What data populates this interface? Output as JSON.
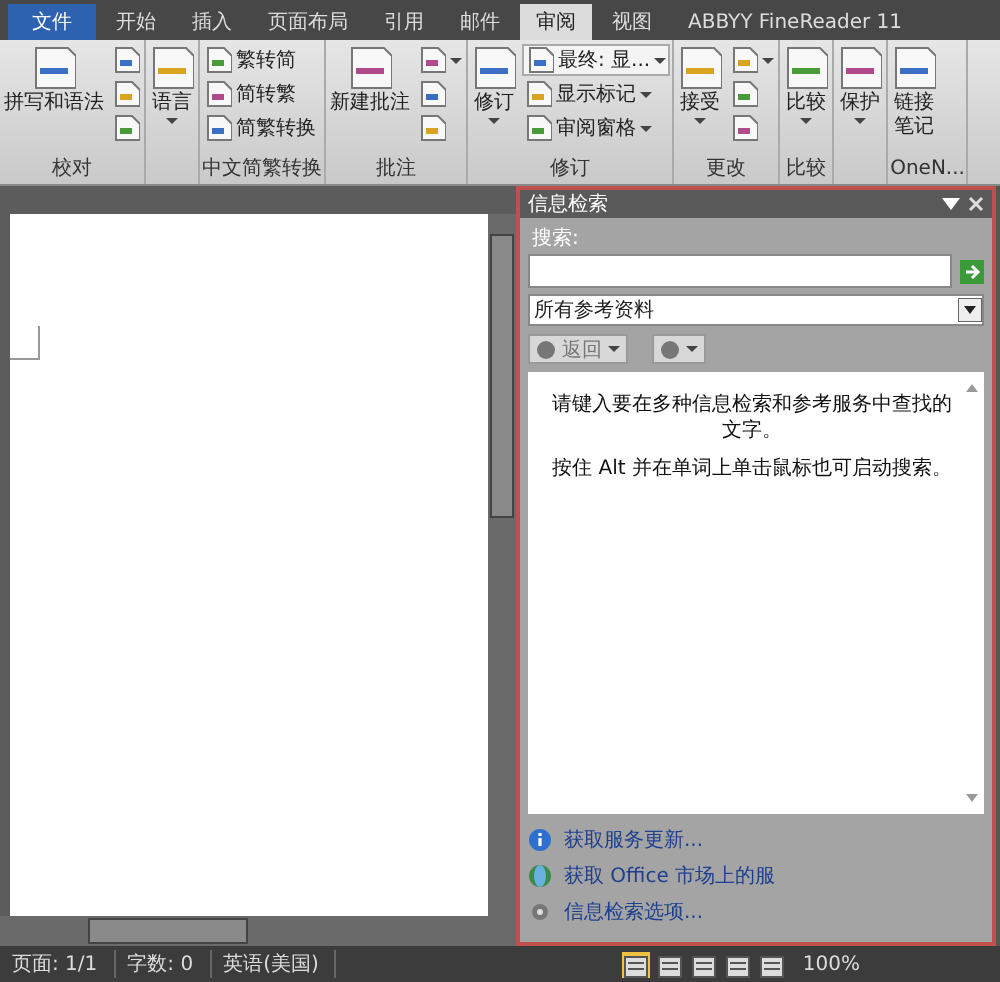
{
  "tabs": [
    {
      "label": "文件",
      "kind": "file",
      "selected": false
    },
    {
      "label": "开始",
      "kind": "tab",
      "selected": false
    },
    {
      "label": "插入",
      "kind": "tab",
      "selected": false
    },
    {
      "label": "页面布局",
      "kind": "tab",
      "selected": false
    },
    {
      "label": "引用",
      "kind": "tab",
      "selected": false
    },
    {
      "label": "邮件",
      "kind": "tab",
      "selected": false
    },
    {
      "label": "审阅",
      "kind": "tab",
      "selected": true
    },
    {
      "label": "视图",
      "kind": "tab",
      "selected": false
    },
    {
      "label": "ABBYY FineReader 11",
      "kind": "tab",
      "selected": false
    }
  ],
  "ribbon": {
    "groups": [
      {
        "label": "校对",
        "items": [
          {
            "kind": "large",
            "label": "拼写和语法",
            "dropdown": false
          },
          {
            "kind": "column",
            "items": [
              {
                "kind": "icon",
                "dropdown": false
              },
              {
                "kind": "icon",
                "dropdown": false
              },
              {
                "kind": "icon",
                "dropdown": false
              }
            ]
          }
        ]
      },
      {
        "items": [
          {
            "kind": "large",
            "label": "语言",
            "dropdown": true
          }
        ]
      },
      {
        "label": "中文简繁转换",
        "items": [
          {
            "kind": "column",
            "items": [
              {
                "kind": "small",
                "label": "繁转简",
                "dropdown": false
              },
              {
                "kind": "small",
                "label": "简转繁",
                "dropdown": false
              },
              {
                "kind": "small",
                "label": "简繁转换",
                "dropdown": false
              }
            ]
          }
        ]
      },
      {
        "label": "批注",
        "items": [
          {
            "kind": "large",
            "label": "新建批注",
            "dropdown": false
          },
          {
            "kind": "column",
            "items": [
              {
                "kind": "icon",
                "dropdown": true
              },
              {
                "kind": "icon",
                "dropdown": false
              },
              {
                "kind": "icon",
                "dropdown": false
              }
            ]
          }
        ]
      },
      {
        "label": "修订",
        "items": [
          {
            "kind": "large",
            "label": "修订",
            "dropdown": true
          },
          {
            "kind": "column",
            "items": [
              {
                "kind": "combo",
                "label": "最终: 显...",
                "dropdown": true
              },
              {
                "kind": "small",
                "label": "显示标记",
                "dropdown": true
              },
              {
                "kind": "small",
                "label": "审阅窗格",
                "dropdown": true
              }
            ]
          }
        ]
      },
      {
        "label": "更改",
        "items": [
          {
            "kind": "large",
            "label": "接受",
            "dropdown": true
          },
          {
            "kind": "column",
            "items": [
              {
                "kind": "icon",
                "dropdown": true
              },
              {
                "kind": "icon",
                "dropdown": false
              },
              {
                "kind": "icon",
                "dropdown": false
              }
            ]
          }
        ]
      },
      {
        "label": "比较",
        "items": [
          {
            "kind": "large",
            "label": "比较",
            "dropdown": true
          }
        ]
      },
      {
        "items": [
          {
            "kind": "large",
            "label": "保护",
            "dropdown": true
          }
        ]
      },
      {
        "label": "OneN...",
        "items": [
          {
            "kind": "tall",
            "label": "链接笔记",
            "dropdown": false
          }
        ]
      }
    ]
  },
  "pane": {
    "title": "信息检索",
    "search_label": "搜索:",
    "scope": "所有参考资料",
    "back": "返回",
    "messages": [
      "请键入要在多种信息检索和参考服务中查找的文字。",
      "按住 Alt 并在单词上单击鼠标也可启动搜索。"
    ],
    "links": [
      {
        "kind": "info",
        "label": "获取服务更新..."
      },
      {
        "kind": "market",
        "label": "获取 Office 市场上的服"
      },
      {
        "kind": "options",
        "label": "信息检索选项..."
      }
    ]
  },
  "status_bar": {
    "items": [
      "页面: 1/1",
      "字数: 0",
      "英语(美国)"
    ],
    "views": [
      {
        "selected": true
      },
      {
        "selected": false
      },
      {
        "selected": false
      },
      {
        "selected": false
      },
      {
        "selected": false
      }
    ],
    "zoom": "100%"
  }
}
